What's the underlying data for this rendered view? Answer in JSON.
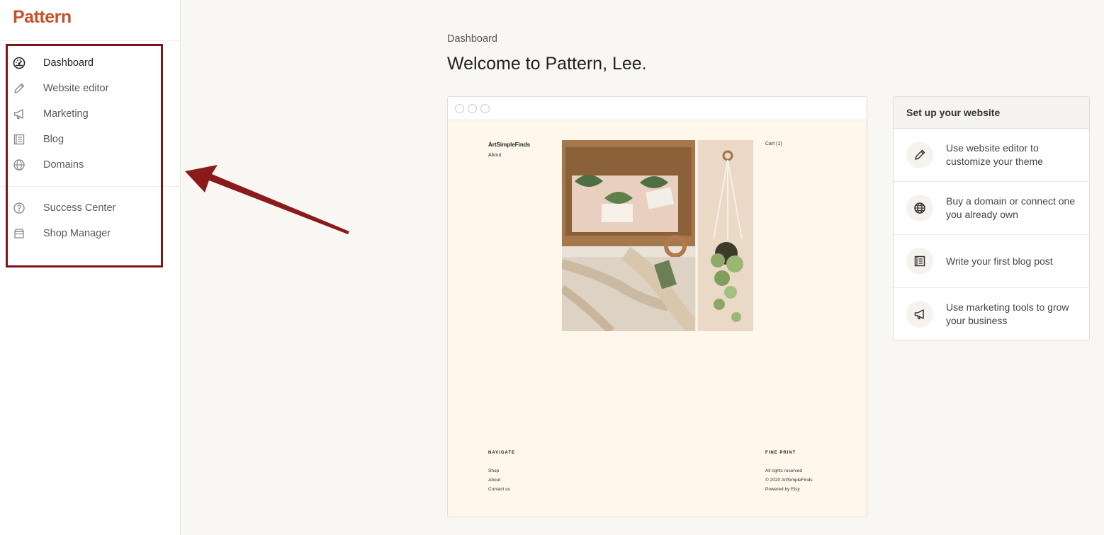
{
  "brand": {
    "name": "Pattern",
    "color": "#c5512b"
  },
  "sidebar": {
    "items": [
      {
        "label": "Dashboard",
        "icon": "dashboard-icon",
        "active": true
      },
      {
        "label": "Website editor",
        "icon": "pencil-icon"
      },
      {
        "label": "Marketing",
        "icon": "megaphone-icon"
      },
      {
        "label": "Blog",
        "icon": "blog-icon"
      },
      {
        "label": "Domains",
        "icon": "globe-icon"
      }
    ],
    "secondary_items": [
      {
        "label": "Success Center",
        "icon": "help-icon"
      },
      {
        "label": "Shop Manager",
        "icon": "shop-icon"
      }
    ]
  },
  "annotation": {
    "color": "#7a1616"
  },
  "main": {
    "breadcrumb": "Dashboard",
    "title": "Welcome to Pattern, Lee."
  },
  "preview": {
    "site_name": "ArtSimpleFinds",
    "nav_about": "About",
    "cart": "Cart (1)",
    "navigate_heading": "NAVIGATE",
    "navigate_links": [
      "Shop",
      "About",
      "Contact us"
    ],
    "fine_print_heading": "FINE PRINT",
    "fine_print_lines": [
      "All rights reserved",
      "© 2020 ArtSimpleFinds",
      "Powered by Etsy"
    ]
  },
  "setup": {
    "title": "Set up your website",
    "items": [
      {
        "label": "Use website editor to customize your theme",
        "icon": "pencil-icon"
      },
      {
        "label": "Buy a domain or connect one you already own",
        "icon": "globe-icon"
      },
      {
        "label": "Write your first blog post",
        "icon": "blog-icon"
      },
      {
        "label": "Use marketing tools to grow your business",
        "icon": "megaphone-icon"
      }
    ]
  }
}
